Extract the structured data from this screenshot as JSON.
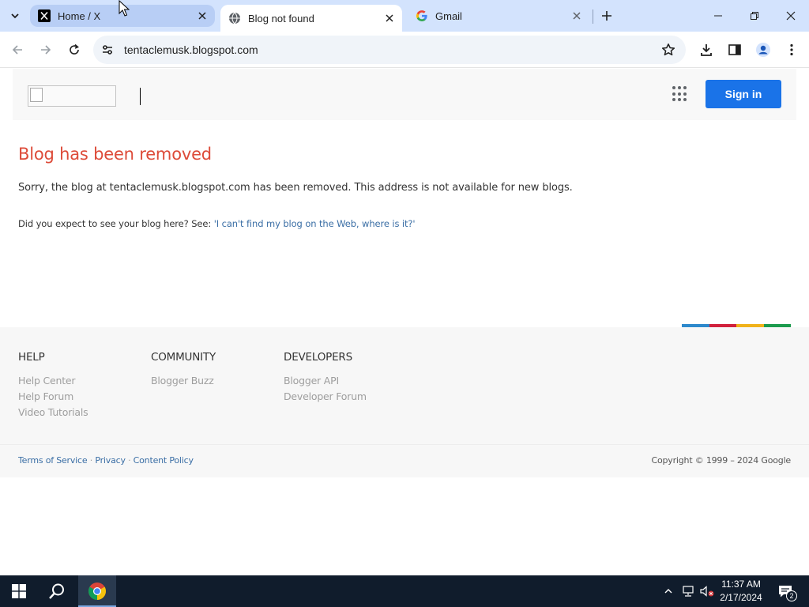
{
  "browser": {
    "tabs": [
      {
        "title": "Home / X",
        "favicon": "x-logo-icon"
      },
      {
        "title": "Blog not found",
        "favicon": "globe-icon"
      },
      {
        "title": "Gmail",
        "favicon": "google-g-icon"
      }
    ],
    "address_url": "tentaclemusk.blogspot.com"
  },
  "header": {
    "signin_label": "Sign in"
  },
  "error": {
    "title": "Blog has been removed",
    "message": "Sorry, the blog at tentaclemusk.blogspot.com has been removed. This address is not available for new blogs.",
    "help_prefix": "Did you expect to see your blog here? See: ",
    "help_link": "'I can't find my blog on the Web, where is it?'"
  },
  "footer": {
    "columns": [
      {
        "heading": "HELP",
        "links": [
          "Help Center",
          "Help Forum",
          "Video Tutorials"
        ]
      },
      {
        "heading": "COMMUNITY",
        "links": [
          "Blogger Buzz"
        ]
      },
      {
        "heading": "DEVELOPERS",
        "links": [
          "Blogger API",
          "Developer Forum"
        ]
      }
    ],
    "legal": {
      "terms": "Terms of Service",
      "privacy": "Privacy",
      "content_policy": "Content Policy",
      "separator": "·"
    },
    "copyright": "Copyright © 1999 – 2024 Google"
  },
  "colors": {
    "accent_blue": "#1a73e8",
    "error_title": "#dd4b39",
    "bar_blue": "#2d89cc",
    "bar_red": "#d1203c",
    "bar_yellow": "#f0b21a",
    "bar_green": "#1c9b4d"
  },
  "taskbar": {
    "time": "11:37 AM",
    "date": "2/17/2024",
    "notification_count": "2"
  }
}
